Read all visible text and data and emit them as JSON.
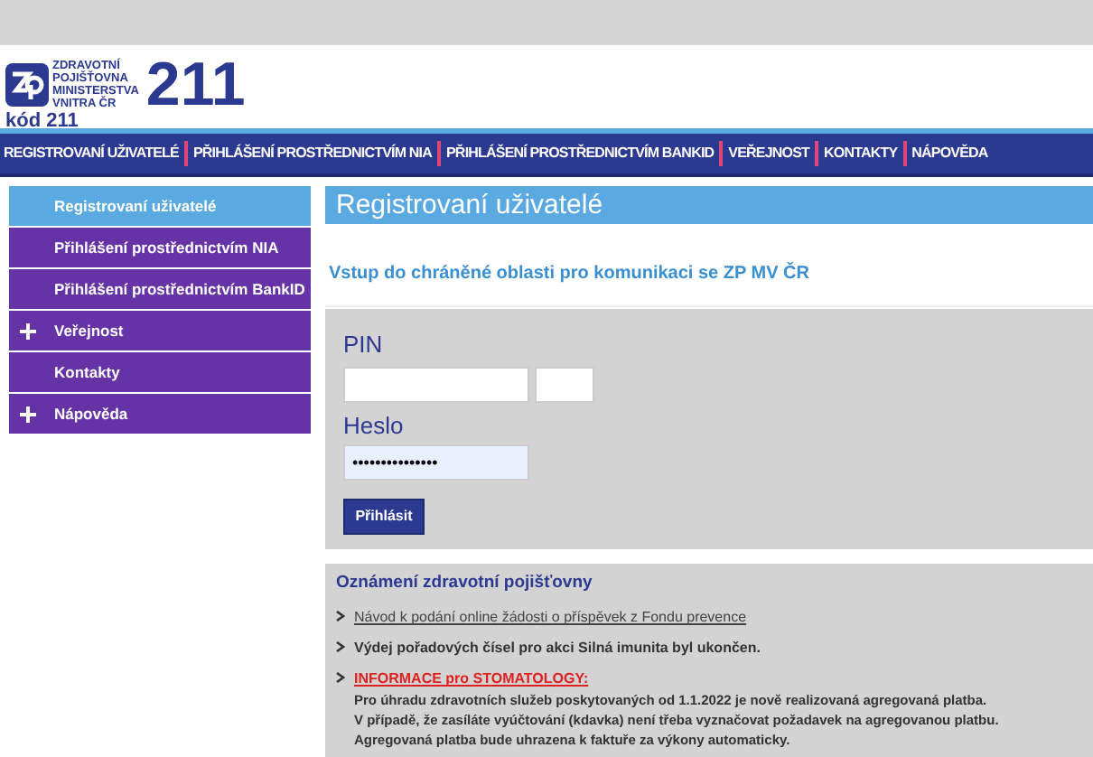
{
  "logo": {
    "lines": [
      "ZDRAVOTNÍ",
      "POJIŠŤOVNA",
      "MINISTERSTVA",
      "VNITRA ČR"
    ],
    "number": "211",
    "code": "kód 211"
  },
  "nav": [
    "REGISTROVANÍ UŽIVATELÉ",
    "PŘIHLÁŠENÍ PROSTŘEDNICTVÍM NIA",
    "PŘIHLÁŠENÍ PROSTŘEDNICTVÍM BANKID",
    "VEŘEJNOST",
    "KONTAKTY",
    "NÁPOVĚDA"
  ],
  "sidebar": {
    "items": [
      {
        "label": "Registrovaní uživatelé",
        "selected": true,
        "expandable": false
      },
      {
        "label": "Přihlášení prostřednictvím NIA",
        "selected": false,
        "expandable": false
      },
      {
        "label": "Přihlášení prostřednictvím BankID",
        "selected": false,
        "expandable": false
      },
      {
        "label": "Veřejnost",
        "selected": false,
        "expandable": true
      },
      {
        "label": "Kontakty",
        "selected": false,
        "expandable": false
      },
      {
        "label": "Nápověda",
        "selected": false,
        "expandable": true
      }
    ]
  },
  "page_title": "Registrovaní uživatelé",
  "subtitle": "Vstup do chráněné oblasti pro komunikaci se ZP MV ČR",
  "login": {
    "pin_label": "PIN",
    "password_label": "Heslo",
    "password_value": "•••••••••••••••",
    "button": "Přihlásit"
  },
  "notices": {
    "title": "Oznámení zdravotní pojišťovny",
    "items": [
      {
        "kind": "link",
        "text": "Návod k podání online žádosti o příspěvek z Fondu prevence"
      },
      {
        "kind": "text",
        "text": "Výdej pořadových čísel pro akci Silná imunita byl ukončen."
      },
      {
        "kind": "alert",
        "text": "INFORMACE pro STOMATOLOGY:",
        "lines": [
          "Pro úhradu zdravotních služeb poskytovaných od 1.1.2022 je nově realizovaná agregovaná platba.",
          "V případě, že zasíláte vyúčtování (kdavka) není třeba vyznačovat požadavek na agregovanou platbu.",
          "Agregovaná platba bude uhrazena k faktuře za výkony automaticky."
        ]
      }
    ]
  }
}
